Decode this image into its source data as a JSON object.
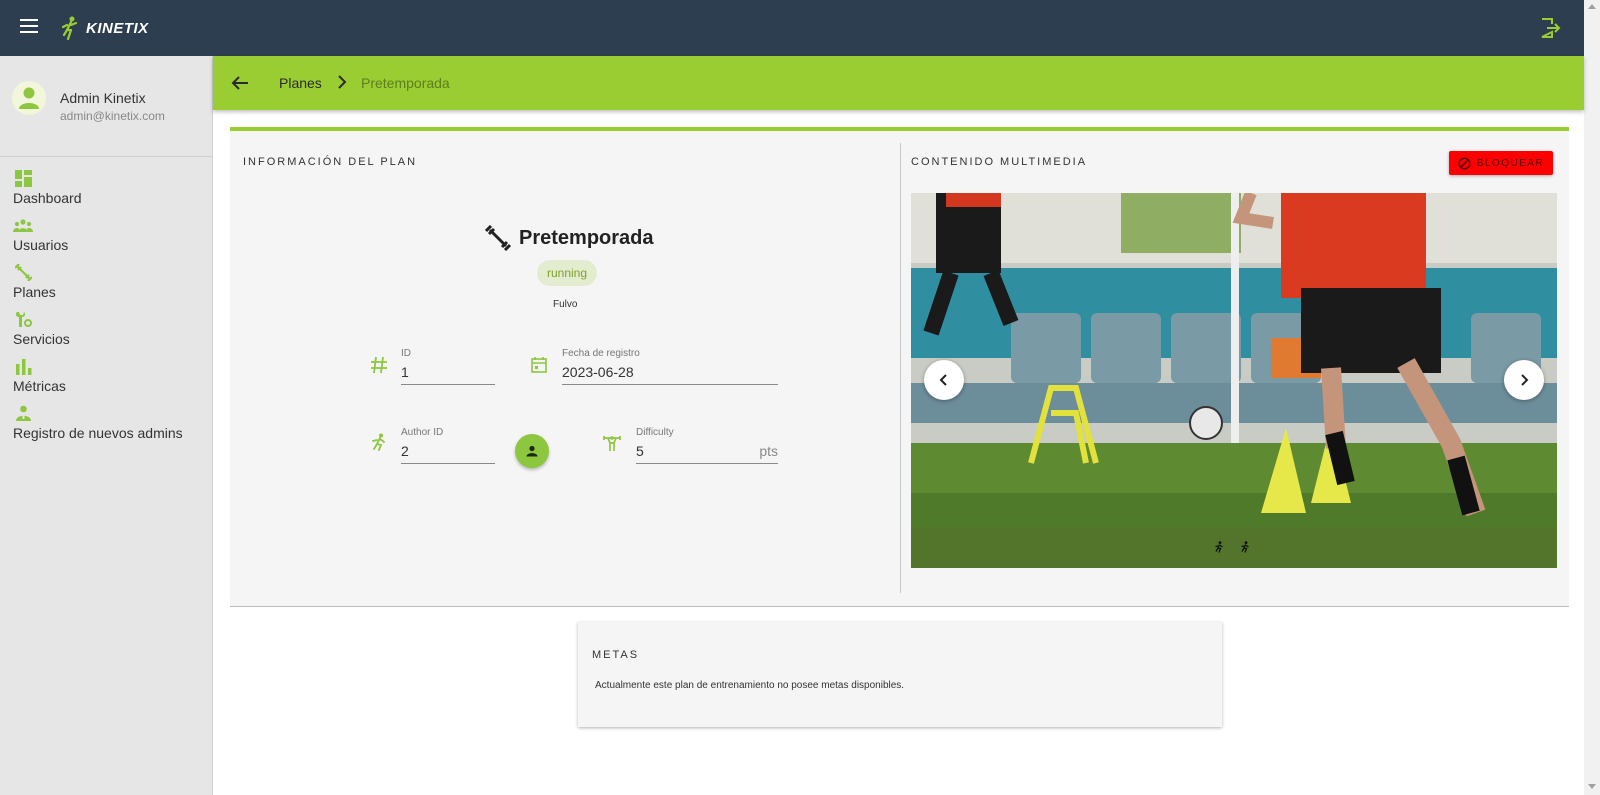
{
  "app": {
    "name": "KINETIX"
  },
  "user": {
    "name": "Admin Kinetix",
    "email": "admin@kinetix.com"
  },
  "sidebar": {
    "items": [
      {
        "label": "Dashboard",
        "icon": "dashboard-icon"
      },
      {
        "label": "Usuarios",
        "icon": "group-icon"
      },
      {
        "label": "Planes",
        "icon": "fitness-icon"
      },
      {
        "label": "Servicios",
        "icon": "build-icon"
      },
      {
        "label": "Métricas",
        "icon": "bar-chart-icon"
      },
      {
        "label": "Registro de nuevos admins",
        "icon": "admin-user-icon"
      }
    ]
  },
  "breadcrumb": {
    "parent": "Planes",
    "current": "Pretemporada"
  },
  "plan_info": {
    "section_title": "INFORMACIÓN DEL PLAN",
    "title": "Pretemporada",
    "tag": "running",
    "sport": "Fulvo",
    "fields": {
      "id": {
        "label": "ID",
        "value": "1"
      },
      "date": {
        "label": "Fecha de registro",
        "value": "2023-06-28"
      },
      "author": {
        "label": "Author ID",
        "value": "2"
      },
      "difficulty": {
        "label": "Difficulty",
        "value": "5",
        "suffix": "pts"
      }
    }
  },
  "multimedia": {
    "section_title": "CONTENIDO MULTIMEDIA",
    "block_label": "BLOQUEAR",
    "slides": 2
  },
  "goals": {
    "title": "METAS",
    "empty_text": "Actualmente este plan de entrenamiento no posee metas disponibles."
  },
  "colors": {
    "topbar": "#2c3e50",
    "accent": "#9acd32",
    "danger": "#ff0000",
    "sidebar": "#e6e6e6",
    "panel": "#f5f5f5"
  }
}
